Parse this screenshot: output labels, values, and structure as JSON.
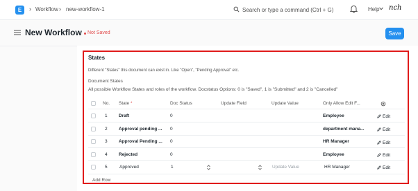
{
  "navbar": {
    "logo_letter": "E",
    "breadcrumbs": [
      "Workflow",
      "new-workflow-1"
    ],
    "search_placeholder": "Search or type a command (Ctrl + G)",
    "help_label": "Help",
    "avatar_text": "nch"
  },
  "header": {
    "title": "New Workflow",
    "status": "Not Saved",
    "save_label": "Save"
  },
  "section": {
    "title": "States",
    "description": "Different \"States\" this document can exist in. Like \"Open\", \"Pending Approval\" etc.",
    "field_label": "Document States",
    "field_description": "All possible Workflow States and roles of the workflow. Docstatus Options: 0 is \"Saved\", 1 is \"Submitted\" and 2 is \"Cancelled\""
  },
  "table": {
    "columns": {
      "no": "No.",
      "state": "State",
      "state_required": "*",
      "doc_status": "Doc Status",
      "update_field": "Update Field",
      "update_value": "Update Value",
      "only_allow_edit": "Only Allow Edit F..."
    },
    "rows": [
      {
        "no": "1",
        "state": "Draft",
        "doc_status": "0",
        "update_field": "",
        "update_value": "",
        "role": "Employee",
        "edit": "Edit"
      },
      {
        "no": "2",
        "state": "Approval pending ...",
        "doc_status": "0",
        "update_field": "",
        "update_value": "",
        "role": "department mana...",
        "edit": "Edit"
      },
      {
        "no": "3",
        "state": "Approval Pending ...",
        "doc_status": "0",
        "update_field": "",
        "update_value": "",
        "role": "HR Manager",
        "edit": "Edit"
      },
      {
        "no": "4",
        "state": "Rejected",
        "doc_status": "0",
        "update_field": "",
        "update_value": "",
        "role": "Employee",
        "edit": "Edit"
      }
    ],
    "editing_row": {
      "no": "5",
      "state": "Approved",
      "doc_status": "1",
      "update_field": "",
      "update_value_placeholder": "Update Value",
      "role": "HR Manager",
      "edit": "Edit"
    },
    "add_row_label": "Add Row"
  },
  "colors": {
    "primary": "#2490ef",
    "danger": "#e24c4c",
    "highlight_border": "#e01b1b"
  }
}
